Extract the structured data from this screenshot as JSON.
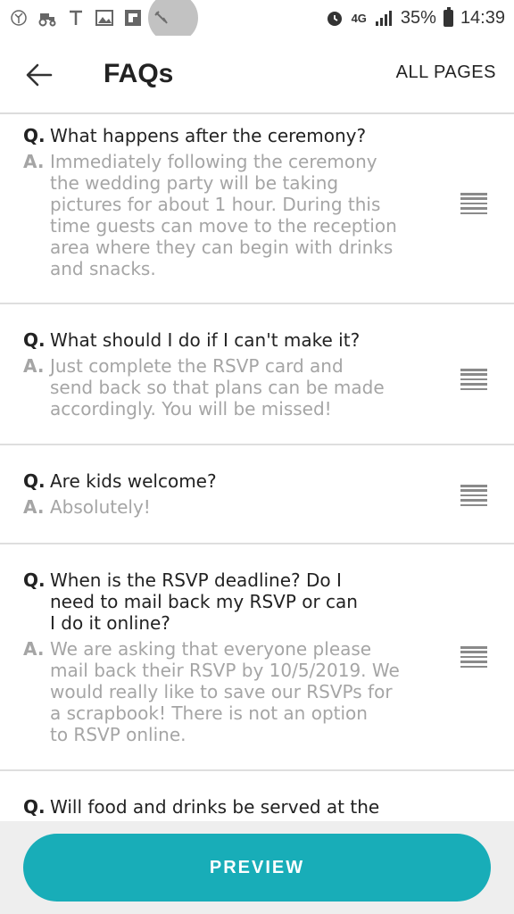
{
  "status_bar": {
    "battery": "35%",
    "time": "14:39",
    "network": "4G",
    "icons_left": [
      "tree-icon",
      "tractor-icon",
      "t-icon",
      "image-icon",
      "flipboard-icon",
      "pin-icon"
    ],
    "icons_right": [
      "alarm-icon",
      "signal-icon",
      "battery-icon"
    ]
  },
  "app_bar": {
    "title": "FAQs",
    "all_pages_label": "ALL PAGES"
  },
  "faqs": [
    {
      "q_prefix": "Q.",
      "a_prefix": "A.",
      "question": [
        "What happens after the ceremony?"
      ],
      "answer": [
        "Immediately following the ceremony",
        "the wedding party will be taking",
        "pictures for about 1 hour. During this",
        "time guests can move to the reception",
        "area where they can begin with drinks",
        "and snacks."
      ]
    },
    {
      "q_prefix": "Q.",
      "a_prefix": "A.",
      "question": [
        "What should I do if I can't make it?"
      ],
      "answer": [
        "Just complete the RSVP card and",
        "send back so that plans can be made",
        "accordingly. You will be missed!"
      ]
    },
    {
      "q_prefix": "Q.",
      "a_prefix": "A.",
      "question": [
        "Are kids welcome?"
      ],
      "answer": [
        "Absolutely!"
      ]
    },
    {
      "q_prefix": "Q.",
      "a_prefix": "A.",
      "question": [
        "When is the RSVP deadline? Do I",
        "need to mail back my RSVP or can",
        "I do it online?"
      ],
      "answer": [
        "We are asking that everyone please",
        "mail back their RSVP by 10/5/2019. We",
        "would really like to save our RSVPs for",
        "a scrapbook! There is not an option",
        "to RSVP online."
      ]
    },
    {
      "q_prefix": "Q.",
      "question": [
        "Will food and drinks be served at the"
      ]
    }
  ],
  "bottom": {
    "preview_label": "PREVIEW"
  },
  "colors": {
    "accent": "#18adb8",
    "answer_text": "#a5a5a5",
    "divider": "#dedede"
  }
}
